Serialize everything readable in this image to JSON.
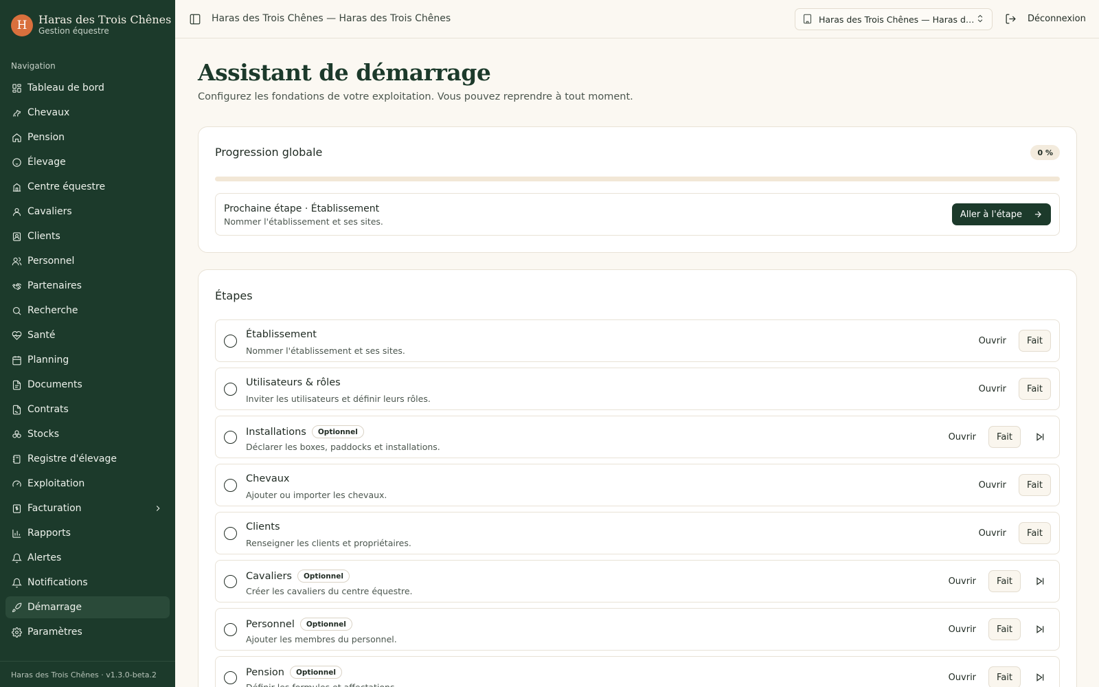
{
  "brand": {
    "initial": "H",
    "name": "Haras des Trois Chênes",
    "subtitle": "Gestion équestre"
  },
  "nav": {
    "heading": "Navigation",
    "items": [
      {
        "label": "Tableau de bord",
        "icon": "dashboard-icon"
      },
      {
        "label": "Chevaux",
        "icon": "horse-icon"
      },
      {
        "label": "Pension",
        "icon": "home-icon"
      },
      {
        "label": "Élevage",
        "icon": "baby-icon"
      },
      {
        "label": "Centre équestre",
        "icon": "school-icon"
      },
      {
        "label": "Cavaliers",
        "icon": "user-icon"
      },
      {
        "label": "Clients",
        "icon": "contact-icon"
      },
      {
        "label": "Personnel",
        "icon": "users-icon"
      },
      {
        "label": "Partenaires",
        "icon": "handshake-icon"
      },
      {
        "label": "Recherche",
        "icon": "search-icon"
      },
      {
        "label": "Santé",
        "icon": "heart-pulse-icon"
      },
      {
        "label": "Planning",
        "icon": "calendar-icon"
      },
      {
        "label": "Documents",
        "icon": "document-icon"
      },
      {
        "label": "Contrats",
        "icon": "file-signature-icon"
      },
      {
        "label": "Stocks",
        "icon": "boxes-icon"
      },
      {
        "label": "Registre d'élevage",
        "icon": "notebook-icon"
      },
      {
        "label": "Exploitation",
        "icon": "gauge-icon"
      },
      {
        "label": "Facturation",
        "icon": "receipt-icon"
      },
      {
        "label": "Rapports",
        "icon": "bar-chart-icon"
      },
      {
        "label": "Alertes",
        "icon": "bell-icon"
      },
      {
        "label": "Notifications",
        "icon": "bell-icon"
      },
      {
        "label": "Démarrage",
        "icon": "rocket-icon"
      },
      {
        "label": "Paramètres",
        "icon": "gear-icon"
      }
    ],
    "active": "Démarrage"
  },
  "footer": {
    "text": "Haras des Trois Chênes · v1.3.0-beta.2"
  },
  "header": {
    "title": "Haras des Trois Chênes — Haras des Trois Chênes",
    "org_select": "Haras des Trois Chênes — Haras de...",
    "logout": "Déconnexion"
  },
  "page": {
    "title": "Assistant de démarrage",
    "subtitle": "Configurez les fondations de votre exploitation. Vous pouvez reprendre à tout moment."
  },
  "progress": {
    "title": "Progression globale",
    "percent_label": "0 %",
    "fraction": 0,
    "next_title": "Prochaine étape · Établissement",
    "next_desc": "Nommer l'établissement et ses sites.",
    "go_label": "Aller à l'étape"
  },
  "steps_card": {
    "title": "Étapes",
    "open_label": "Ouvrir",
    "done_label": "Fait",
    "optional_label": "Optionnel",
    "steps": [
      {
        "name": "Établissement",
        "desc": "Nommer l'établissement et ses sites.",
        "optional": false
      },
      {
        "name": "Utilisateurs & rôles",
        "desc": "Inviter les utilisateurs et définir leurs rôles.",
        "optional": false
      },
      {
        "name": "Installations",
        "desc": "Déclarer les boxes, paddocks et installations.",
        "optional": true
      },
      {
        "name": "Chevaux",
        "desc": "Ajouter ou importer les chevaux.",
        "optional": false
      },
      {
        "name": "Clients",
        "desc": "Renseigner les clients et propriétaires.",
        "optional": false
      },
      {
        "name": "Cavaliers",
        "desc": "Créer les cavaliers du centre équestre.",
        "optional": true
      },
      {
        "name": "Personnel",
        "desc": "Ajouter les membres du personnel.",
        "optional": true
      },
      {
        "name": "Pension",
        "desc": "Définir les formules et affectations.",
        "optional": true
      }
    ]
  },
  "colors": {
    "sidebar_bg": "#1c3a2b",
    "accent": "#1c3a2b",
    "brand_logo": "#d9703d",
    "page_bg": "#fbf8f2"
  }
}
